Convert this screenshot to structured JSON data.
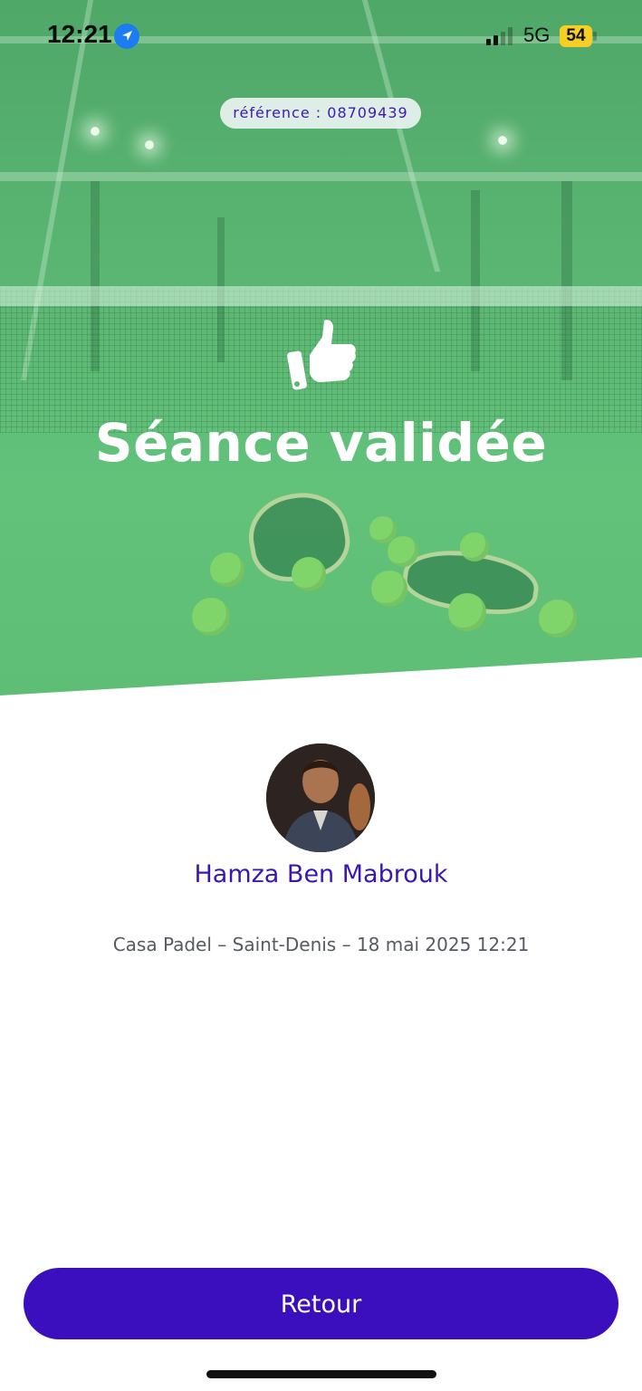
{
  "status_bar": {
    "time": "12:21",
    "network": "5G",
    "battery": "54",
    "location_icon": "location-arrow-icon",
    "battery_color": "#f5cf23"
  },
  "hero": {
    "reference": "référence : 08709439",
    "icon": "thumbs-up-icon",
    "title": "Séance validée",
    "overlay_color": "#5bb673"
  },
  "player": {
    "name": "Hamza Ben Mabrouk",
    "details": "Casa Padel – Saint-Denis – 18 mai 2025 12:21"
  },
  "actions": {
    "back_label": "Retour",
    "accent_color": "#3b0fbd"
  }
}
